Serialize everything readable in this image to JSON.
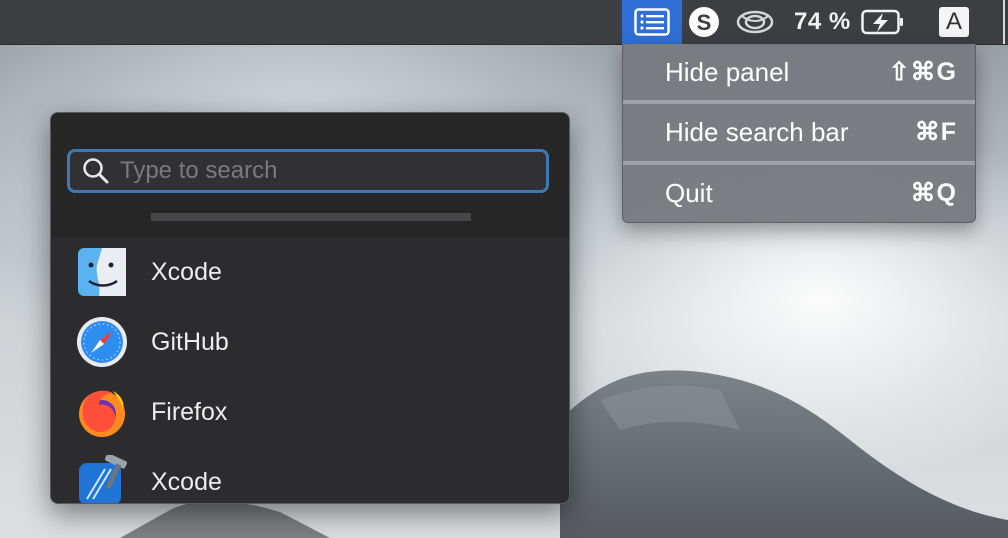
{
  "menubar": {
    "panel_icon": "list-panel-icon",
    "skype_icon": "skype-icon",
    "eye_icon": "eye-icon",
    "battery_percent": "74 %",
    "battery_icon": "battery-charging-icon",
    "input_source": "A",
    "accent_color": "#2f6fd6"
  },
  "menu": {
    "items": [
      {
        "label": "Hide panel",
        "shortcut": "⇧⌘G"
      },
      {
        "label": "Hide search bar",
        "shortcut": "⌘F"
      },
      {
        "label": "Quit",
        "shortcut": "⌘Q"
      }
    ]
  },
  "panel": {
    "search": {
      "placeholder": "Type to search",
      "value": ""
    },
    "apps": [
      {
        "name": "Xcode",
        "icon": "finder-icon"
      },
      {
        "name": "GitHub",
        "icon": "safari-icon"
      },
      {
        "name": "Firefox",
        "icon": "firefox-icon"
      },
      {
        "name": "Xcode",
        "icon": "xcode-icon"
      }
    ]
  }
}
